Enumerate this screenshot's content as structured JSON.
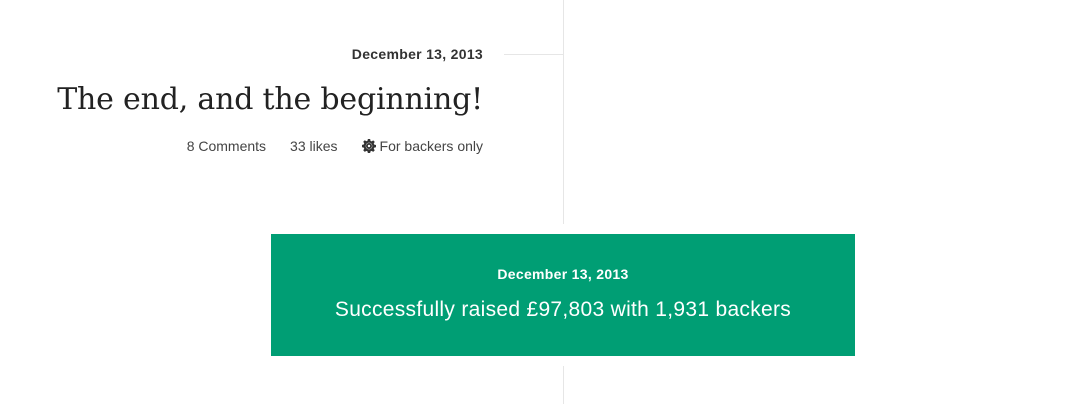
{
  "post": {
    "date": "December 13, 2013",
    "title": "The end, and the beginning!",
    "comments_label": "8 Comments",
    "likes_label": "33 likes",
    "backers_only_label": "For backers only",
    "backers_only_icon": "gear-icon"
  },
  "milestone": {
    "date": "December 13, 2013",
    "text": "Successfully raised £97,803 with 1,931 backers",
    "background_color": "#009e74"
  }
}
